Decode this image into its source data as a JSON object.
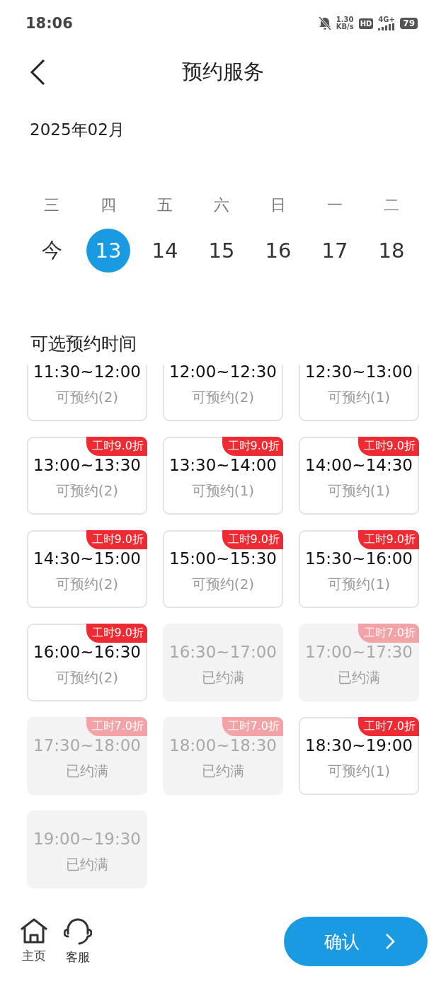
{
  "status_bar": {
    "time": "18:06",
    "speed_value": "1.30",
    "speed_unit": "KB/s",
    "hd": "HD",
    "network": "4G+",
    "battery": "79"
  },
  "header": {
    "title": "预约服务"
  },
  "month": "2025年02月",
  "days": [
    {
      "weekday": "三",
      "date": "今",
      "selected": false
    },
    {
      "weekday": "四",
      "date": "13",
      "selected": true
    },
    {
      "weekday": "五",
      "date": "14",
      "selected": false
    },
    {
      "weekday": "六",
      "date": "15",
      "selected": false
    },
    {
      "weekday": "日",
      "date": "16",
      "selected": false
    },
    {
      "weekday": "一",
      "date": "17",
      "selected": false
    },
    {
      "weekday": "二",
      "date": "18",
      "selected": false
    }
  ],
  "slots_title": "可选预约时间",
  "slot_rows": [
    [
      {
        "time": "11:30~12:00",
        "status": "可预约(2)",
        "available": true
      },
      {
        "time": "12:00~12:30",
        "status": "可预约(2)",
        "available": true
      },
      {
        "time": "12:30~13:00",
        "status": "可预约(1)",
        "available": true
      }
    ],
    [
      {
        "time": "13:00~13:30",
        "status": "可预约(2)",
        "available": true,
        "badge": "工时9.0折"
      },
      {
        "time": "13:30~14:00",
        "status": "可预约(1)",
        "available": true,
        "badge": "工时9.0折"
      },
      {
        "time": "14:00~14:30",
        "status": "可预约(1)",
        "available": true,
        "badge": "工时9.0折"
      }
    ],
    [
      {
        "time": "14:30~15:00",
        "status": "可预约(2)",
        "available": true,
        "badge": "工时9.0折"
      },
      {
        "time": "15:00~15:30",
        "status": "可预约(2)",
        "available": true,
        "badge": "工时9.0折"
      },
      {
        "time": "15:30~16:00",
        "status": "可预约(1)",
        "available": true,
        "badge": "工时9.0折"
      }
    ],
    [
      {
        "time": "16:00~16:30",
        "status": "可预约(2)",
        "available": true,
        "badge": "工时9.0折"
      },
      {
        "time": "16:30~17:00",
        "status": "已约满",
        "available": false
      },
      {
        "time": "17:00~17:30",
        "status": "已约满",
        "available": false,
        "badge": "工时7.0折"
      }
    ],
    [
      {
        "time": "17:30~18:00",
        "status": "已约满",
        "available": false,
        "badge": "工时7.0折"
      },
      {
        "time": "18:00~18:30",
        "status": "已约满",
        "available": false,
        "badge": "工时7.0折"
      },
      {
        "time": "18:30~19:00",
        "status": "可预约(1)",
        "available": true,
        "badge": "工时7.0折"
      }
    ],
    [
      {
        "time": "19:00~19:30",
        "status": "已约满",
        "available": false
      }
    ]
  ],
  "bottom_nav": [
    {
      "kind": "home",
      "label": "主页"
    },
    {
      "kind": "service",
      "label": "客服"
    }
  ],
  "confirm_button": "确认"
}
